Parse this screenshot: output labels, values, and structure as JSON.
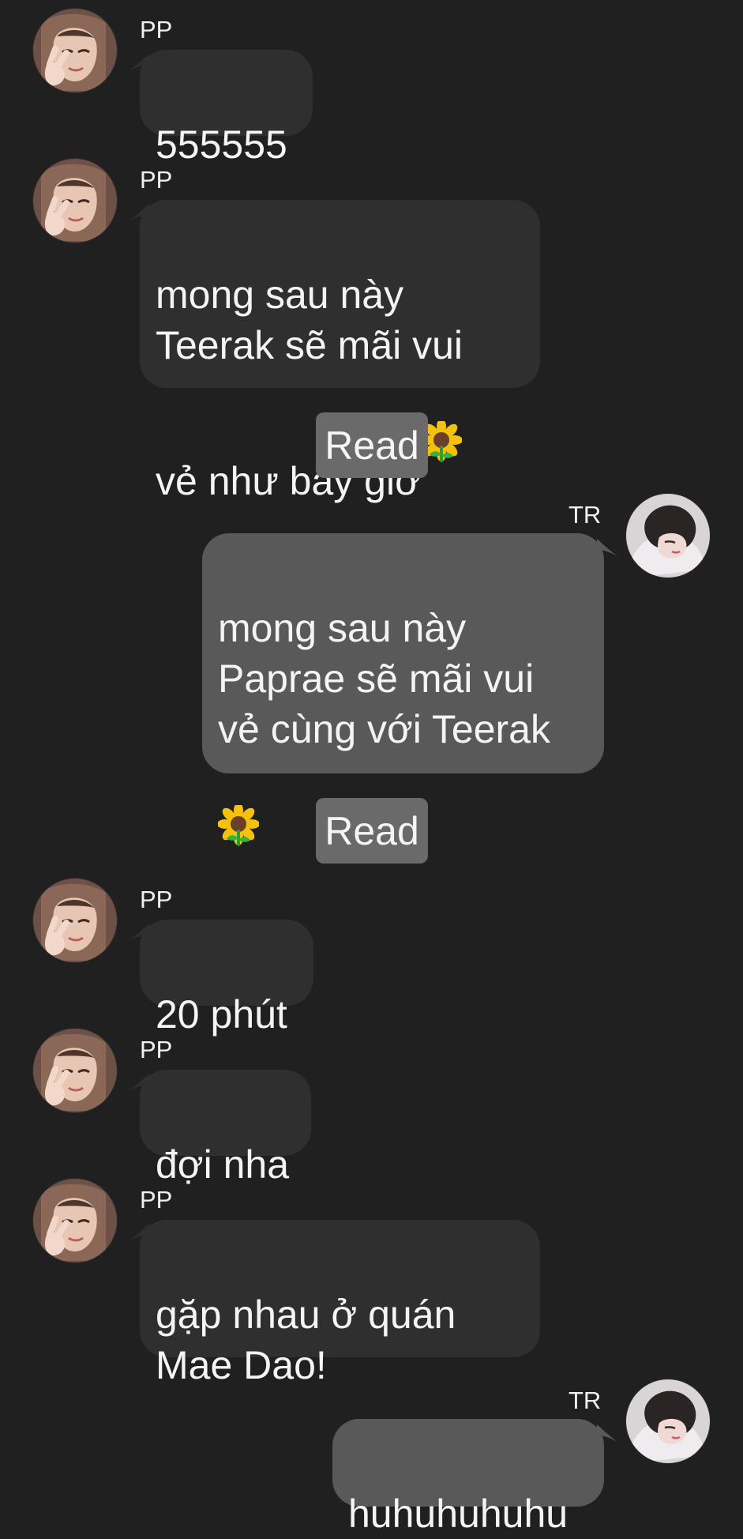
{
  "colors": {
    "background": "#202020",
    "incoming_bubble": "#2f2f2f",
    "outgoing_bubble": "#595959",
    "read_chip": "#6a6a6a",
    "text": "#f4f4f4"
  },
  "messages": [
    {
      "side": "left",
      "sender": "PP",
      "text": "555555",
      "avatar": "pp-avatar"
    },
    {
      "side": "left",
      "sender": "PP",
      "text": "mong sau này\nTeerak sẽ mãi vui\nvẻ như bây giờ",
      "emoji": "sunflower-emoji",
      "avatar": "pp-avatar"
    },
    {
      "side": "read",
      "label": "Read"
    },
    {
      "side": "right",
      "sender": "TR",
      "text": "mong sau này\nPaprae sẽ mãi vui\nvẻ cùng với Teerak",
      "emoji": "sunflower-emoji",
      "avatar": "tr-avatar"
    },
    {
      "side": "read",
      "label": "Read"
    },
    {
      "side": "left",
      "sender": "PP",
      "text": "20 phút",
      "avatar": "pp-avatar"
    },
    {
      "side": "left",
      "sender": "PP",
      "text": "đợi nha",
      "avatar": "pp-avatar"
    },
    {
      "side": "left",
      "sender": "PP",
      "text": "gặp nhau ở quán\nMae Dao!",
      "avatar": "pp-avatar"
    },
    {
      "side": "right",
      "sender": "TR",
      "text": "huhuhuhuhu",
      "avatar": "tr-avatar"
    }
  ]
}
